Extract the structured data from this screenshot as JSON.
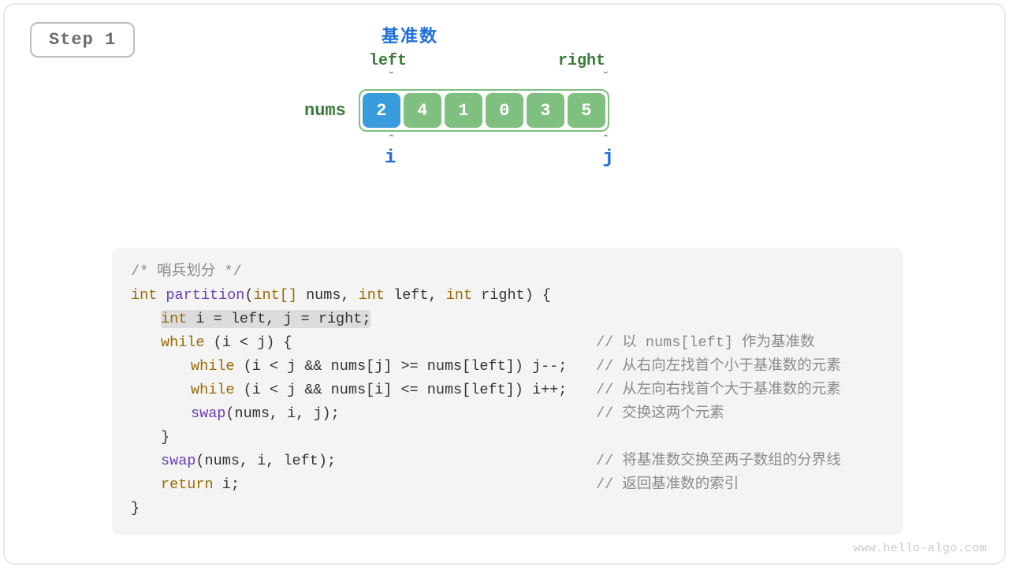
{
  "step_label": "Step 1",
  "pivot_label": "基准数",
  "left_label": "left",
  "right_label": "right",
  "nums_label": "nums",
  "i_label": "i",
  "j_label": "j",
  "array": [
    "2",
    "4",
    "1",
    "0",
    "3",
    "5"
  ],
  "pivot_index": 0,
  "left_index": 0,
  "right_index": 5,
  "i_index": 0,
  "j_index": 5,
  "code": {
    "comment_title": "/* 哨兵划分 */",
    "l1_int": "int",
    "l1_fn": "partition",
    "l1_rest_a": "(",
    "l1_intarr": "int[]",
    "l1_rest_b": " nums, ",
    "l1_int2": "int",
    "l1_rest_c": " left, ",
    "l1_int3": "int",
    "l1_rest_d": " right) {",
    "l2_int": "int",
    "l2_rest": " i = left, j = right;",
    "l3_while": "while",
    "l3_rest": " (i < j) {",
    "l3_cmt": "// 以 nums[left] 作为基准数",
    "l4_while": "while",
    "l4_rest": " (i < j && nums[j] >= nums[left]) j--;",
    "l4_cmt": "// 从右向左找首个小于基准数的元素",
    "l5_while": "while",
    "l5_rest": " (i < j && nums[i] <= nums[left]) i++;",
    "l5_cmt": "// 从左向右找首个大于基准数的元素",
    "l6_swap": "swap",
    "l6_rest": "(nums, i, j);",
    "l6_cmt": "// 交换这两个元素",
    "l7": "}",
    "l8_swap": "swap",
    "l8_rest": "(nums, i, left);",
    "l8_cmt": "// 将基准数交换至两子数组的分界线",
    "l9_return": "return",
    "l9_rest": " i;",
    "l9_cmt": "// 返回基准数的索引",
    "l10": "}"
  },
  "watermark": "www.hello-algo.com"
}
